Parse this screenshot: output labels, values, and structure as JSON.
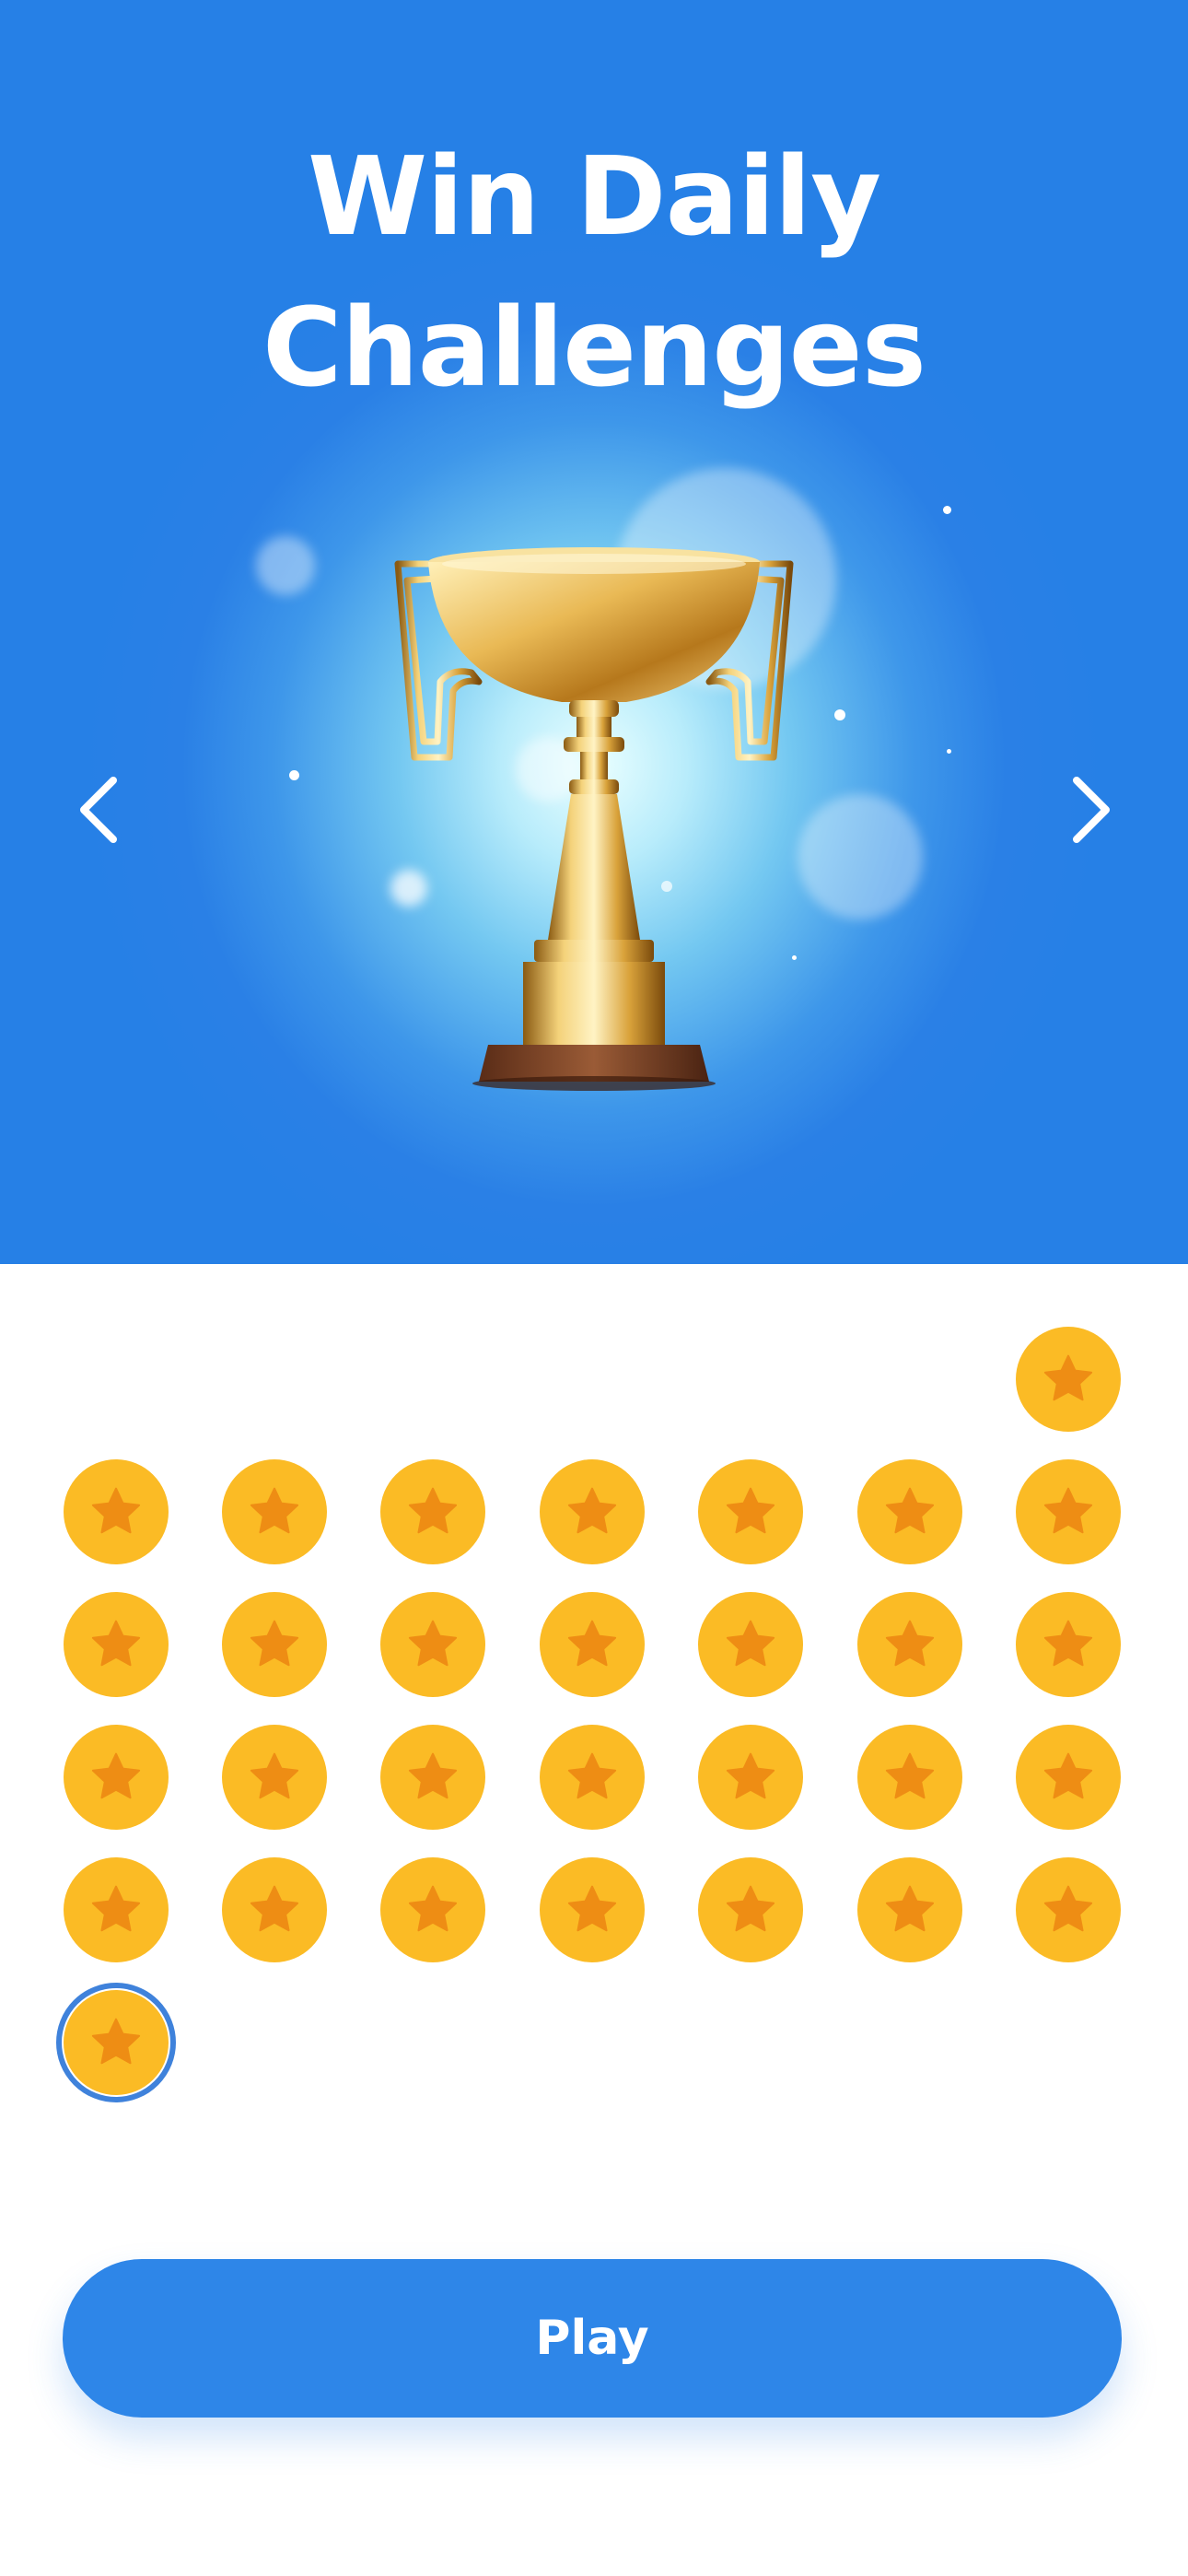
{
  "hero": {
    "title_line1": "Win Daily",
    "title_line2": "Challenges",
    "background_color": "#2680E6",
    "image": "gold-trophy"
  },
  "carousel": {
    "prev_icon": "chevron-left-icon",
    "next_icon": "chevron-right-icon"
  },
  "badges": {
    "total": 30,
    "icon": "star-icon",
    "coin_color": "#FBBB25",
    "star_color": "#EE8D14",
    "selected_index": 29,
    "selected_ring_color": "#3F82DB"
  },
  "play_button": {
    "label": "Play",
    "color": "#2E86E8"
  }
}
